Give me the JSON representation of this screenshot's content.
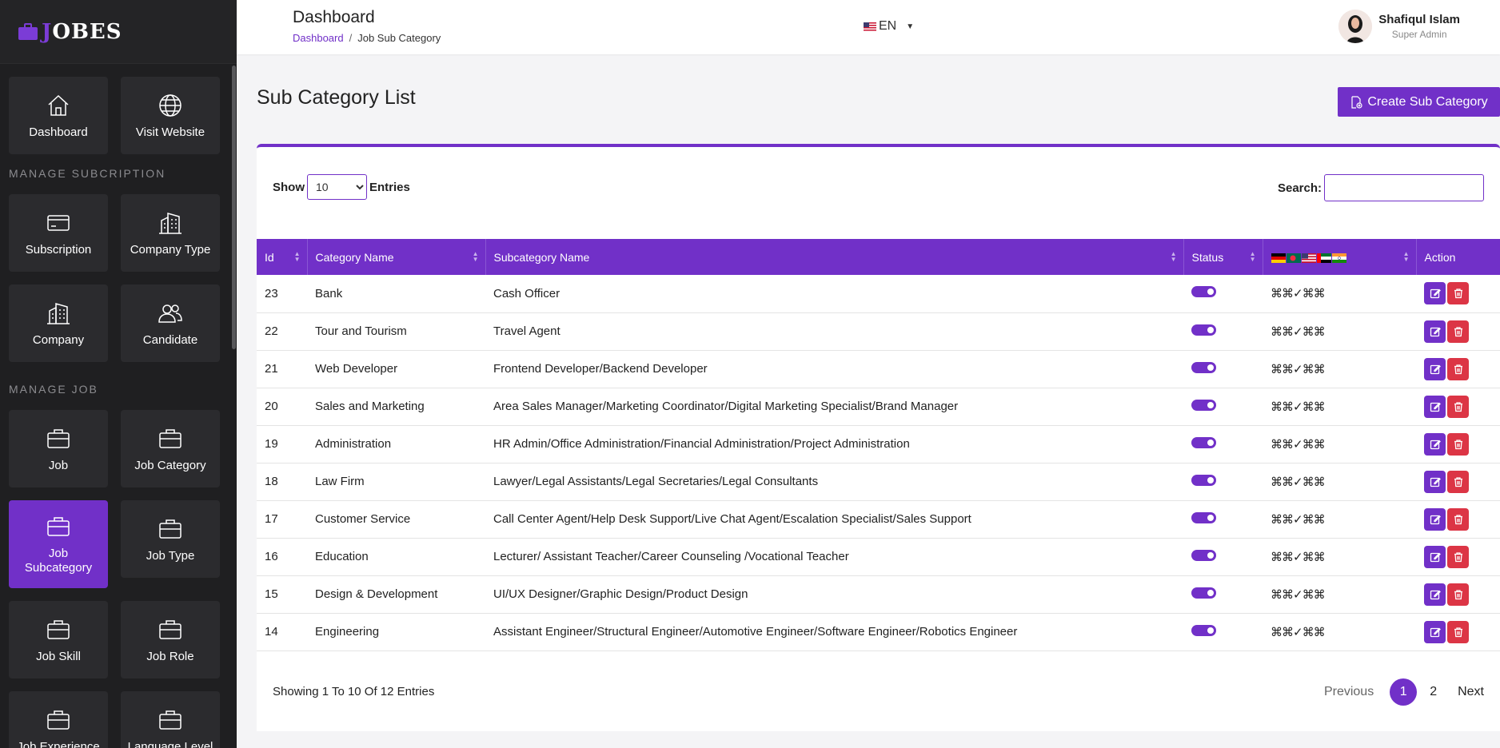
{
  "brand": {
    "text_j": "J",
    "text_rest": "OBES"
  },
  "sidebar": {
    "top_tiles": [
      {
        "label": "Dashboard",
        "icon": "home-icon"
      },
      {
        "label": "Visit Website",
        "icon": "globe-icon"
      }
    ],
    "section_subscription": "MANAGE SUBCRIPTION",
    "subscription_tiles": [
      {
        "label": "Subscription",
        "icon": "card-icon"
      },
      {
        "label": "Company Type",
        "icon": "building-icon"
      },
      {
        "label": "Company",
        "icon": "building-icon"
      },
      {
        "label": "Candidate",
        "icon": "users-icon"
      }
    ],
    "section_job": "MANAGE JOB",
    "job_tiles": [
      {
        "label": "Job",
        "icon": "briefcase-icon"
      },
      {
        "label": "Job Category",
        "icon": "briefcase-icon"
      },
      {
        "label": "Job Subcategory",
        "icon": "briefcase-icon",
        "active": true
      },
      {
        "label": "Job Type",
        "icon": "briefcase-icon"
      },
      {
        "label": "Job Skill",
        "icon": "briefcase-icon"
      },
      {
        "label": "Job Role",
        "icon": "briefcase-icon"
      },
      {
        "label": "Job Experience",
        "icon": "briefcase-icon"
      },
      {
        "label": "Language Level",
        "icon": "briefcase-icon"
      }
    ]
  },
  "header": {
    "title": "Dashboard",
    "breadcrumb": [
      "Dashboard",
      "Job Sub Category"
    ],
    "breadcrumb_sep": "/",
    "language": "EN",
    "user_name": "Shafiqul Islam",
    "user_role": "Super Admin"
  },
  "content": {
    "title": "Sub Category List",
    "create_label": "Create Sub Category"
  },
  "table_controls": {
    "show_label": "Show",
    "entries_label": "Entries",
    "page_size": "10",
    "search_label": "Search:"
  },
  "table": {
    "columns": [
      "Id",
      "Category Name",
      "Subcategory Name",
      "Status",
      "",
      "Action"
    ],
    "translate_marks": "⌘⌘✓⌘⌘",
    "rows": [
      {
        "id": "23",
        "category": "Bank",
        "subcategory": "Cash Officer"
      },
      {
        "id": "22",
        "category": "Tour and Tourism",
        "subcategory": "Travel Agent"
      },
      {
        "id": "21",
        "category": "Web Developer",
        "subcategory": "Frontend Developer/Backend Developer"
      },
      {
        "id": "20",
        "category": "Sales and Marketing",
        "subcategory": "Area Sales Manager/Marketing Coordinator/Digital Marketing Specialist/Brand Manager"
      },
      {
        "id": "19",
        "category": "Administration",
        "subcategory": "HR Admin/Office Administration/Financial Administration/Project Administration"
      },
      {
        "id": "18",
        "category": "Law Firm",
        "subcategory": "Lawyer/Legal Assistants/Legal Secretaries/Legal Consultants"
      },
      {
        "id": "17",
        "category": "Customer Service",
        "subcategory": "Call Center Agent/Help Desk Support/Live Chat Agent/Escalation Specialist/Sales Support"
      },
      {
        "id": "16",
        "category": "Education",
        "subcategory": "Lecturer/ Assistant Teacher/Career Counseling /Vocational Teacher"
      },
      {
        "id": "15",
        "category": "Design & Development",
        "subcategory": "UI/UX Designer/Graphic Design/Product Design"
      },
      {
        "id": "14",
        "category": "Engineering",
        "subcategory": "Assistant Engineer/Structural Engineer/Automotive Engineer/Software Engineer/Robotics Engineer"
      }
    ]
  },
  "footer": {
    "info": "Showing 1 To 10 Of 12 Entries",
    "prev": "Previous",
    "pages": [
      "1",
      "2"
    ],
    "next": "Next"
  },
  "colors": {
    "accent": "#7130c8",
    "danger": "#dc3545",
    "sidebar": "#1f1f21"
  }
}
